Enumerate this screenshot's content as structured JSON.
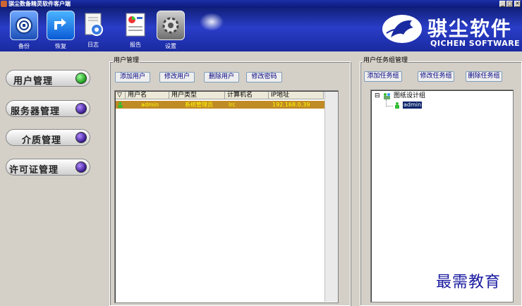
{
  "window": {
    "title": "骐尘数备精灵软件客户端",
    "minimize": "_",
    "maximize": "□",
    "close": "✕"
  },
  "toolbar": {
    "backup_label": "备份",
    "restore_label": "恢复",
    "log_label": "日志",
    "report_label": "报告",
    "settings_label": "设置"
  },
  "brand": {
    "name_cn": "骐尘软件",
    "name_en": "QICHEN SOFTWARE"
  },
  "nav": {
    "items": [
      {
        "label": "用户管理",
        "indicator": "green",
        "active": true
      },
      {
        "label": "服务器管理",
        "indicator": "purple",
        "active": false
      },
      {
        "label": "介质管理",
        "indicator": "purple",
        "active": false
      },
      {
        "label": "许可证管理",
        "indicator": "purple",
        "active": false
      }
    ]
  },
  "user_panel": {
    "title": "用户管理",
    "buttons": {
      "add": "添加用户",
      "edit": "修改用户",
      "delete": "删除用户",
      "change_password": "修改密码"
    },
    "columns": [
      "用户名",
      "用户类型",
      "计算机名",
      "IP地址"
    ],
    "rows": [
      {
        "username": "admin",
        "type": "系统管理员",
        "computer": "lrc",
        "ip": "192.168.0.39"
      }
    ]
  },
  "group_panel": {
    "title": "用户任务组管理",
    "buttons": {
      "add": "添加任务组",
      "edit": "修改任务组",
      "delete": "删除任务组"
    },
    "tree": {
      "root": "图纸设计组",
      "expander": "⊟",
      "children": [
        "admin"
      ]
    }
  },
  "watermark": "最需教育",
  "colors": {
    "banner": "#1a2aa0",
    "selected_row": "#c08a25",
    "selected_row_text": "#ffff00",
    "active_indicator": "#1a9a1a",
    "inactive_indicator": "#3a1890"
  }
}
